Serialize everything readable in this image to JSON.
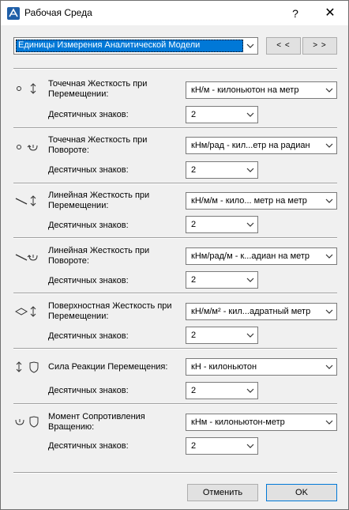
{
  "window": {
    "title": "Рабочая Среда",
    "help": "?",
    "close": "✕"
  },
  "top": {
    "selected": "Единицы Измерения Аналитической Модели",
    "prev_label": "< <",
    "next_label": "> >"
  },
  "sections": [
    {
      "label": "Точечная Жесткость при Перемещении:",
      "unit": "кН/м - килоньютон на метр",
      "decimals_label": "Десятичных знаков:",
      "decimals": "2"
    },
    {
      "label": "Точечная Жесткость при Повороте:",
      "unit": "кНм/рад - кил...етр на радиан",
      "decimals_label": "Десятичных знаков:",
      "decimals": "2"
    },
    {
      "label": "Линейная Жесткость при Перемещении:",
      "unit": "кН/м/м - кило... метр на метр",
      "decimals_label": "Десятичных знаков:",
      "decimals": "2"
    },
    {
      "label": "Линейная Жесткость при Повороте:",
      "unit": "кНм/рад/м - к...адиан на метр",
      "decimals_label": "Десятичных знаков:",
      "decimals": "2"
    },
    {
      "label": "Поверхностная Жесткость при Перемещении:",
      "unit": "кН/м/м² - кил...адратный метр",
      "decimals_label": "Десятичных знаков:",
      "decimals": "2"
    },
    {
      "label": "Сила Реакции Перемещения:",
      "unit": "кН - килоньютон",
      "decimals_label": "Десятичных знаков:",
      "decimals": "2"
    },
    {
      "label": "Момент Сопротивления Вращению:",
      "unit": "кНм - килоньютон-метр",
      "decimals_label": "Десятичных знаков:",
      "decimals": "2"
    }
  ],
  "footer": {
    "cancel_label": "Отменить",
    "ok_label": "OK"
  }
}
